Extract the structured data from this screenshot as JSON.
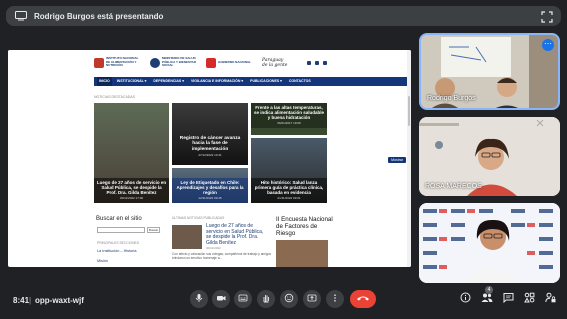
{
  "presenting": {
    "text": "Rodrigo Burgos está presentando"
  },
  "shared_screen": {
    "header": {
      "logo1": "INSTITUTO NACIONAL DE ALIMENTACIÓN Y NUTRICIÓN",
      "logo2": "MINISTERIO DE SALUD PÚBLICA Y BIENESTAR SOCIAL",
      "logo3": "GOBIERNO NACIONAL",
      "logo4": "Paraguay de la gente"
    },
    "nav": [
      "INICIO",
      "INSTITUCIONAL ▾",
      "DEPENDENCIAS ▾",
      "VIGILANCIA E INFORMACIÓN ▾",
      "PUBLICACIONES ▾",
      "CONTACTOS"
    ],
    "section_title": "NOTICIAS DESTACADAS",
    "news": [
      {
        "title": "Luego de 27 años de servicio en Salud Pública, se despide la Prof. Dra. Gilda Benítez",
        "date": "30/11/2022 17:00"
      },
      {
        "title": "Registro de cáncer avanza hacia la fase de implementación",
        "date": "27/12/2022 10:41"
      },
      {
        "title": "Frente a las altas temperaturas, se indica alimentación saludable y buena hidratación",
        "date": "06/01/2017 19:09"
      },
      {
        "title": "Ley de Etiquetado en Chile: Aprendizajes y desafíos para la región",
        "date": "12/11/2022 09:45"
      },
      {
        "title": "Hito histórico: Salud lanza primera guía de práctica clínica, basada en evidencia",
        "date": "21/11/2022 09:01"
      }
    ],
    "mostrar": "Mostrar",
    "search": {
      "label": "Buscar en el sitio",
      "button": "Buscar"
    },
    "side": {
      "section": "PRINCIPALES SECCIONES",
      "links": [
        "La Institución – Historia",
        "Misión"
      ]
    },
    "recent": {
      "title": "ÚLTIMAS NOTICIAS PUBLICADAS",
      "headline": "Luego de 27 años de servicio en Salud Pública, se despide la Prof. Dra. Gilda Benítez",
      "date": "30/11/2022",
      "text": "Con afecto y valoración sus colegas, compañeros de trabajo y amigos brindaron un emotivo homenaje a..."
    },
    "encuesta": "II Encuesta Nacional de Factores de Riesgo"
  },
  "participants": [
    {
      "name": "Rodrigo Burgos"
    },
    {
      "name": "ROSA MARECOS"
    },
    {
      "name": ""
    }
  ],
  "meeting": {
    "time": "8:41",
    "separator": "|",
    "code": "opp-waxt-wjf",
    "participant_count": "4"
  },
  "colors": {
    "background": "#202124",
    "end_call": "#ea4335",
    "nav_blue": "#14357a",
    "active_border": "#8ab4f8"
  }
}
